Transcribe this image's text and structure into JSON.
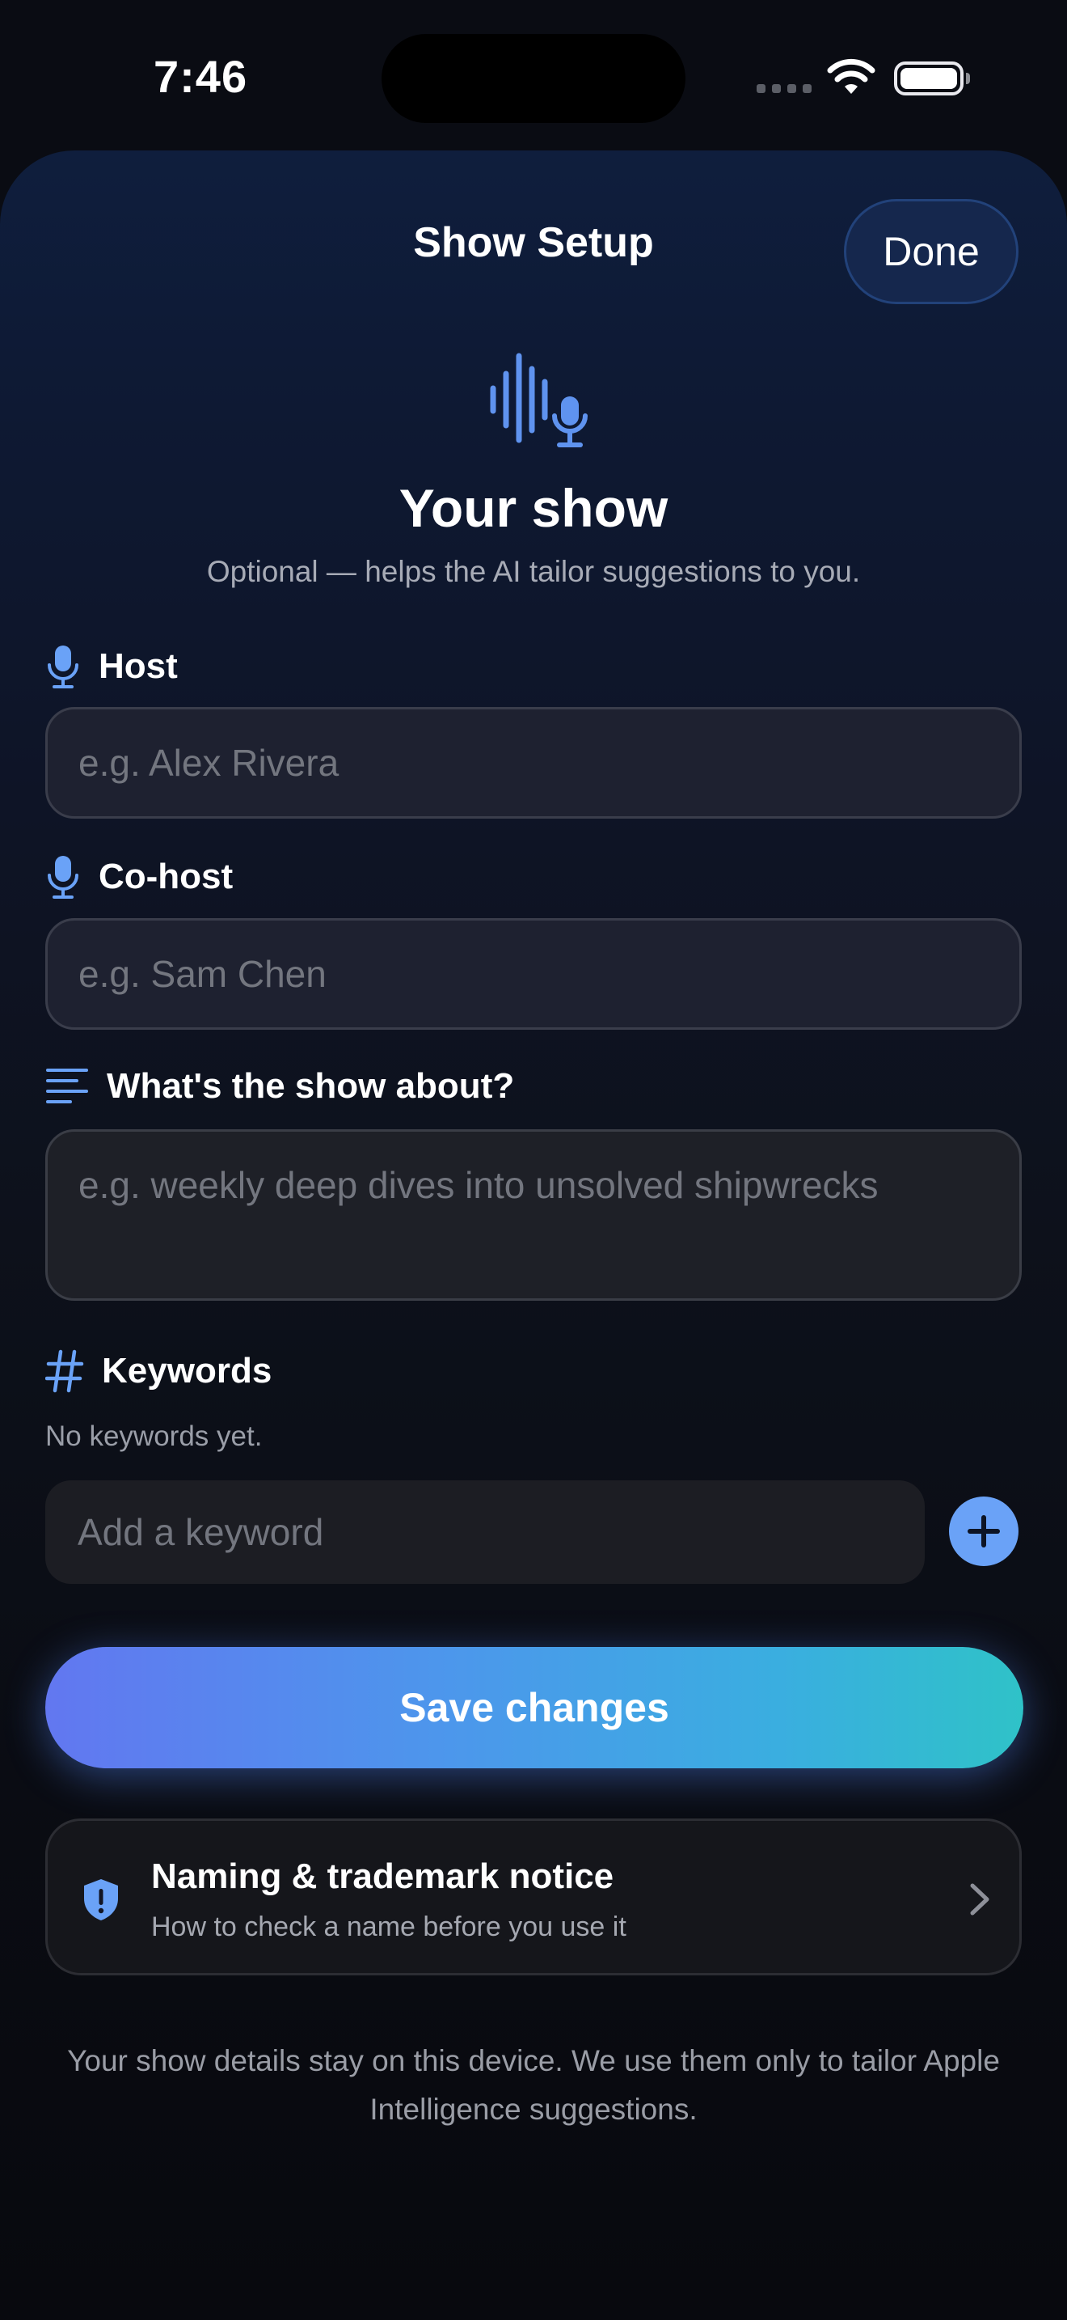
{
  "status_bar": {
    "time": "7:46"
  },
  "nav": {
    "title": "Show Setup",
    "done_label": "Done"
  },
  "hero": {
    "title": "Your show",
    "subtitle": "Optional — helps the AI tailor suggestions to you."
  },
  "fields": {
    "host": {
      "label": "Host",
      "placeholder": "e.g. Alex Rivera",
      "value": ""
    },
    "cohost": {
      "label": "Co-host",
      "placeholder": "e.g. Sam Chen",
      "value": ""
    },
    "about": {
      "label": "What's the show about?",
      "placeholder": "e.g. weekly deep dives into unsolved shipwrecks",
      "value": ""
    }
  },
  "keywords": {
    "label": "Keywords",
    "empty_text": "No keywords yet.",
    "placeholder": "Add a keyword"
  },
  "save": {
    "label": "Save changes"
  },
  "notice": {
    "title": "Naming & trademark notice",
    "subtitle": "How to check a name before you use it"
  },
  "footer": {
    "text": "Your show details stay on this device. We use them only to tailor Apple Intelligence suggestions."
  },
  "colors": {
    "accent": "#6aa2f7",
    "gradient_start": "#6277f0",
    "gradient_end": "#2fc2c8",
    "done_bg": "#15274d"
  },
  "icons": {
    "hero": "waveform-mic-icon",
    "host": "mic-icon",
    "cohost": "mic-icon",
    "about": "text-align-left-icon",
    "keywords": "hashtag-icon",
    "notice": "shield-exclamation-icon",
    "disclosure": "chevron-right-icon"
  }
}
